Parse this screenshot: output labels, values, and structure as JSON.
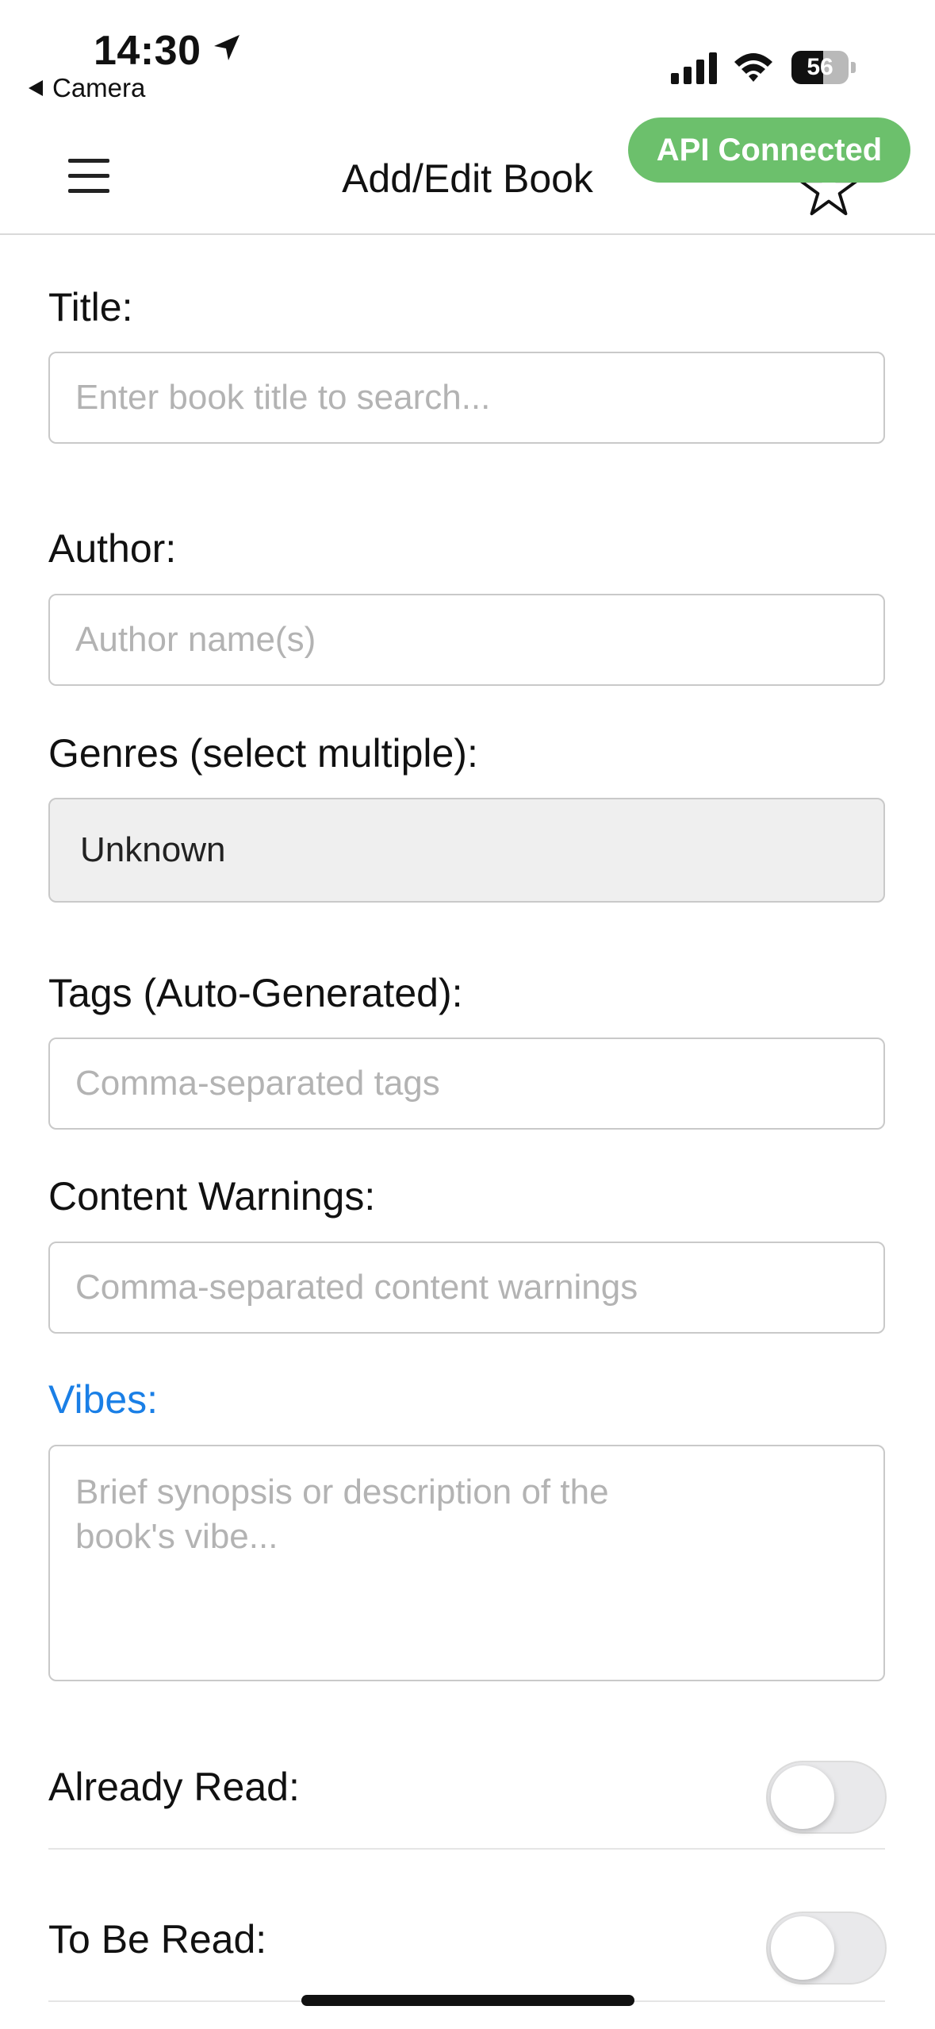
{
  "status_bar": {
    "time": "14:30",
    "back_app": "Camera",
    "battery_level": "56"
  },
  "header": {
    "title": "Add/Edit Book",
    "api_status": "API Connected",
    "api_status_color": "#6cc06c"
  },
  "form": {
    "title": {
      "label": "Title:",
      "placeholder": "Enter book title to search..."
    },
    "author": {
      "label": "Author:",
      "placeholder": "Author name(s)"
    },
    "genres": {
      "label": "Genres (select multiple):",
      "value": "Unknown"
    },
    "tags": {
      "label": "Tags (Auto-Generated):",
      "placeholder": "Comma-separated tags"
    },
    "content_warnings": {
      "label": "Content Warnings:",
      "placeholder": "Comma-separated content warnings"
    },
    "vibes": {
      "label": "Vibes:",
      "placeholder": "Brief synopsis or description of the book's vibe...",
      "label_color": "#1a7fe6"
    },
    "already_read": {
      "label": "Already Read:",
      "on": false
    },
    "to_be_read": {
      "label": "To Be Read:",
      "on": false
    }
  },
  "icons": {
    "location": "location-arrow-icon",
    "signal": "cellular-signal-icon",
    "wifi": "wifi-icon",
    "battery": "battery-icon",
    "menu": "hamburger-menu-icon",
    "favorite": "star-icon"
  }
}
